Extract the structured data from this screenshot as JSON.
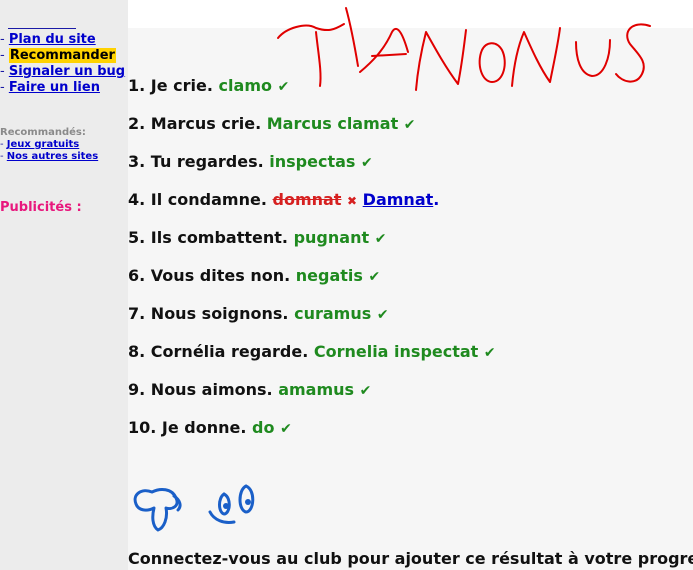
{
  "sidebar": {
    "nav": [
      {
        "label": "Plan du site"
      },
      {
        "label": "Recommander"
      },
      {
        "label": "Signaler un bug"
      },
      {
        "label": "Faire un lien"
      }
    ],
    "recommended_title": "Recommandés:",
    "recommended": [
      {
        "label": "Jeux gratuits"
      },
      {
        "label": "Nos autres sites"
      }
    ],
    "ads_title": "Publicités :"
  },
  "exercises": [
    {
      "number": "1.",
      "prompt": "Je crie.",
      "answer": "clamo"
    },
    {
      "number": "2.",
      "prompt": "Marcus crie.",
      "answer": "Marcus clamat"
    },
    {
      "number": "3.",
      "prompt": "Tu regardes.",
      "answer": "inspectas"
    },
    {
      "number": "4.",
      "prompt": "Il condamne.",
      "wrong_answer": "domnat",
      "correction": "Damnat",
      "end": "."
    },
    {
      "number": "5.",
      "prompt": "Ils combattent.",
      "answer": "pugnant"
    },
    {
      "number": "6.",
      "prompt": "Vous dites non.",
      "answer": "negatis"
    },
    {
      "number": "7.",
      "prompt": "Nous soignons.",
      "answer": "curamus"
    },
    {
      "number": "8.",
      "prompt": "Cornélia regarde.",
      "answer": "Cornelia inspectat"
    },
    {
      "number": "9.",
      "prompt": "Nous aimons.",
      "answer": "amamus"
    },
    {
      "number": "10.",
      "prompt": "Je donne.",
      "answer": "do"
    }
  ],
  "icons": {
    "correct": "✔",
    "wrong": "✖"
  },
  "club_text": "Connectez-vous au club pour ajouter ce résultat à votre progre",
  "colors": {
    "correct": "#1f8a1f",
    "wrong": "#d62020",
    "link": "#0000cc",
    "highlight": "#ffd200",
    "ads": "#e8177d",
    "scribble": "#e00000",
    "mascot": "#1a5fc8"
  }
}
